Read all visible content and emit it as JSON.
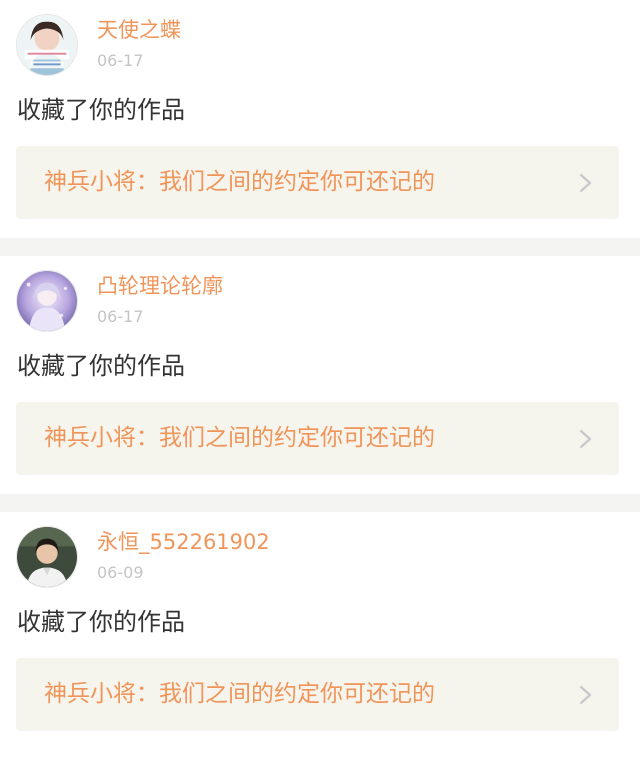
{
  "notifications": [
    {
      "username": "天使之蝶",
      "date": "06-17",
      "action": "收藏了你的作品",
      "work_title": "神兵小将：我们之间的约定你可还记的",
      "avatar_icon": "avatar-girl-photo-icon"
    },
    {
      "username": "凸轮理论轮廓",
      "date": "06-17",
      "action": "收藏了你的作品",
      "work_title": "神兵小将：我们之间的约定你可还记的",
      "avatar_icon": "avatar-anime-purple-icon"
    },
    {
      "username": "永恒_552261902",
      "date": "06-09",
      "action": "收藏了你的作品",
      "work_title": "神兵小将：我们之间的约定你可还记的",
      "avatar_icon": "avatar-person-photo-icon"
    }
  ],
  "colors": {
    "accent": "#f0955a",
    "date": "#c4c4c4",
    "body_text": "#333333",
    "work_box_bg": "#f5f4ed",
    "separator": "#f4f4f2",
    "chevron": "#c8c8c8"
  }
}
